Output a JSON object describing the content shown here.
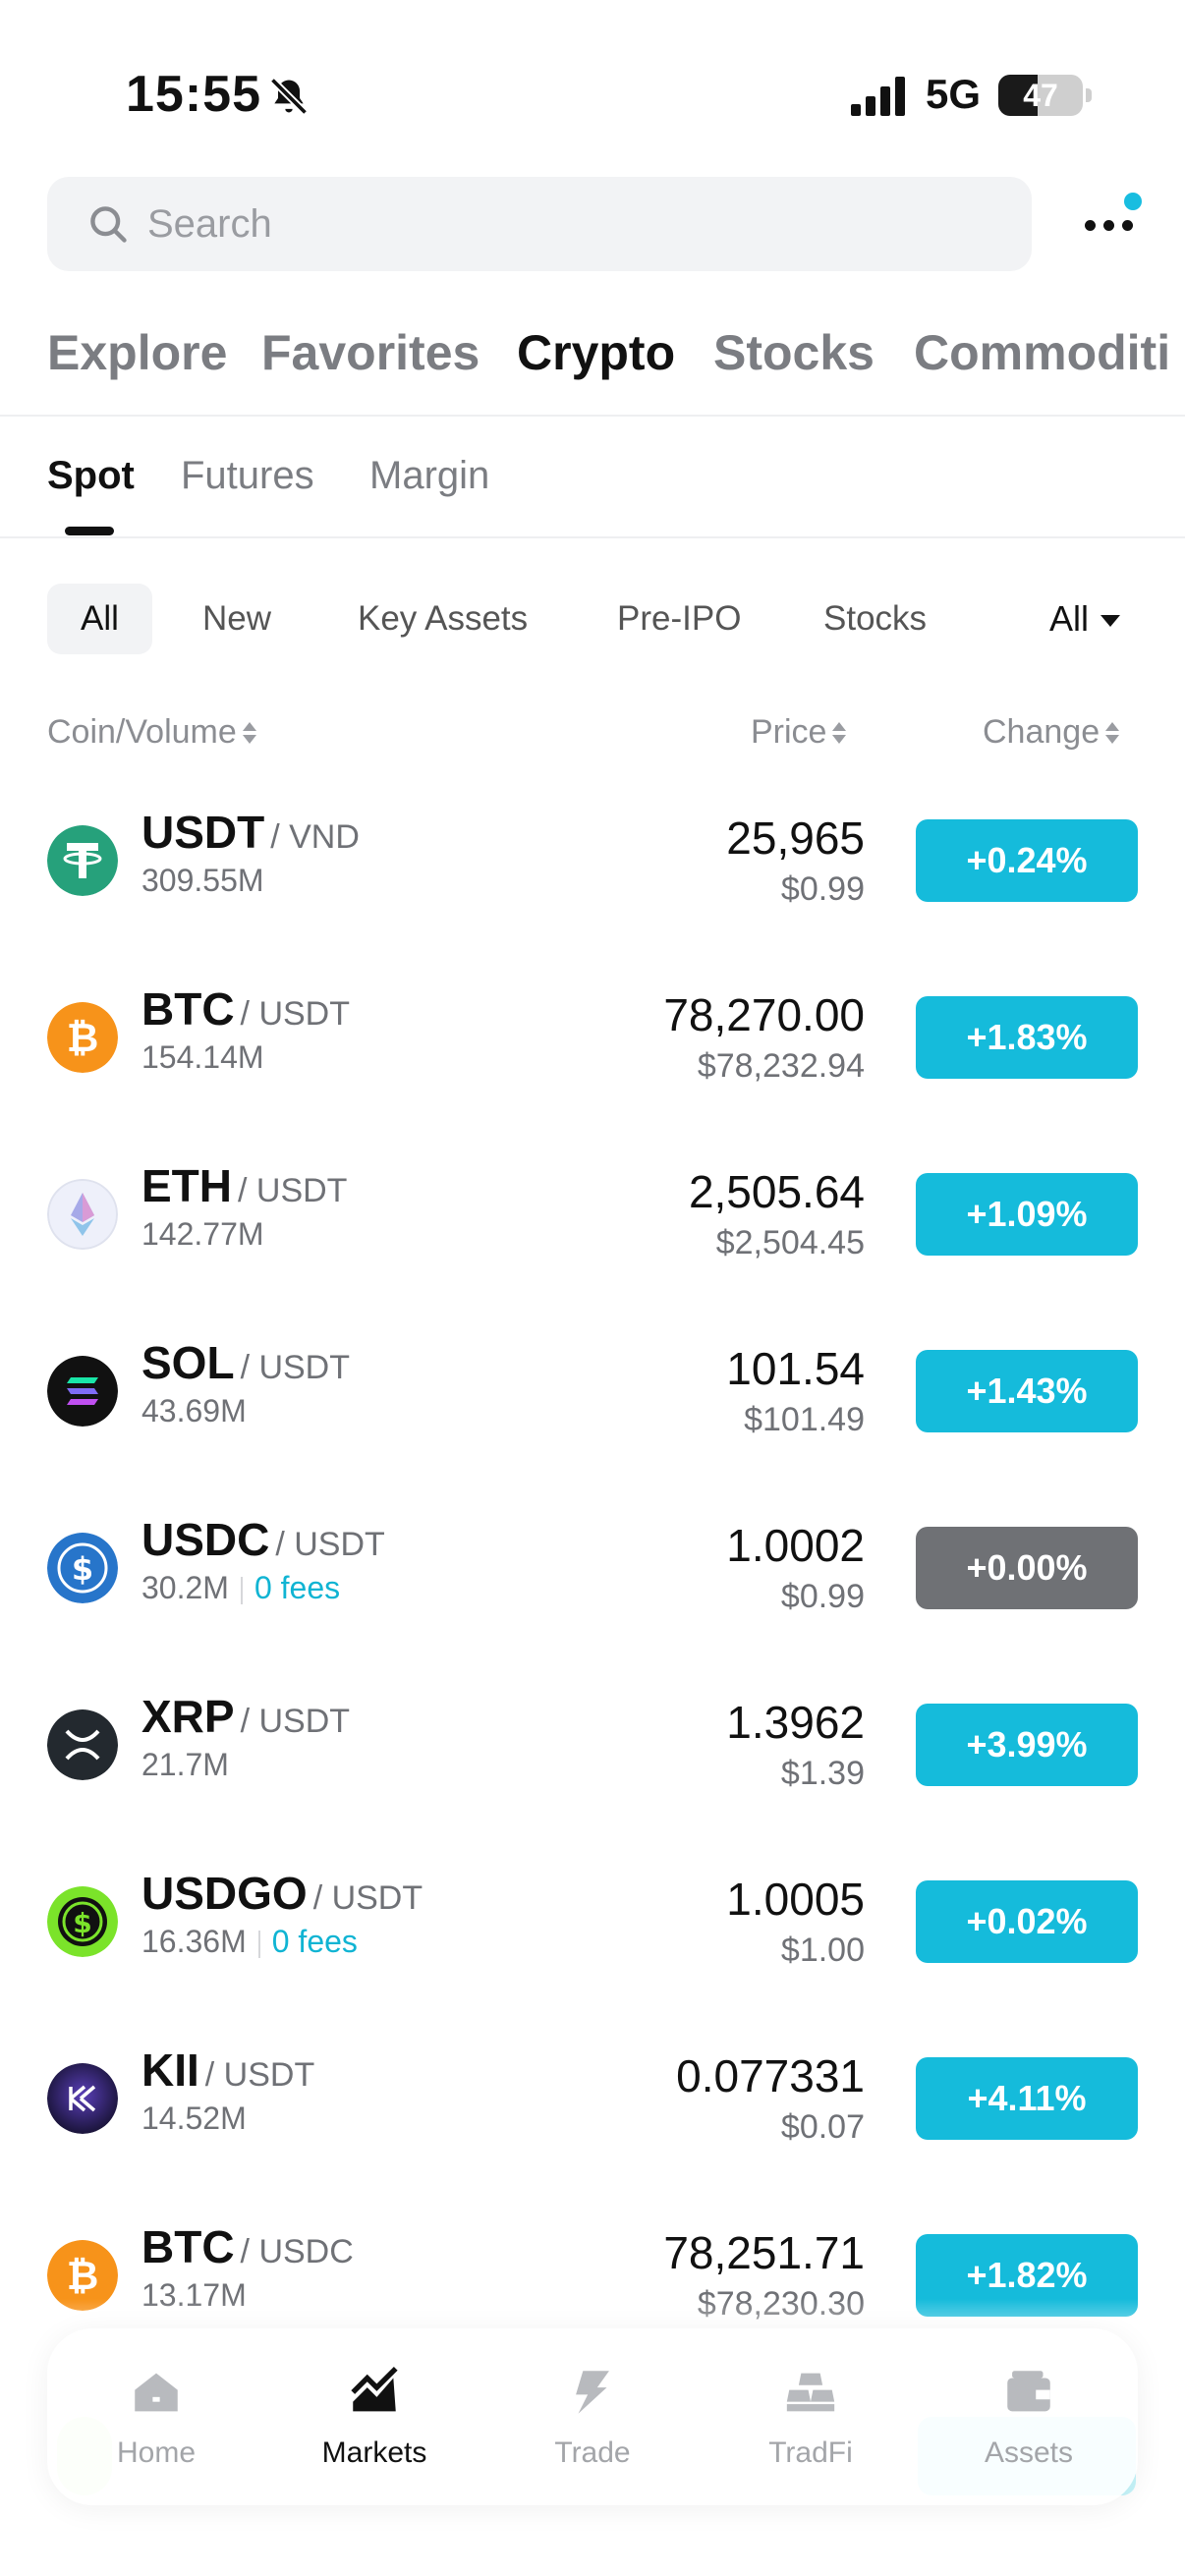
{
  "status_bar": {
    "time": "15:55",
    "network": "5G",
    "battery": "47",
    "battery_fraction": 0.47
  },
  "search": {
    "placeholder": "Search"
  },
  "main_tabs": [
    {
      "label": "Explore"
    },
    {
      "label": "Favorites"
    },
    {
      "label": "Crypto",
      "active": true
    },
    {
      "label": "Stocks"
    },
    {
      "label": "Commoditi"
    }
  ],
  "sub_tabs": [
    {
      "label": "Spot",
      "active": true
    },
    {
      "label": "Futures"
    },
    {
      "label": "Margin"
    }
  ],
  "filters": {
    "chips": [
      "All",
      "New",
      "Key Assets",
      "Pre-IPO",
      "Stocks"
    ],
    "dropdown": "All"
  },
  "table_header": {
    "coin": "Coin/Volume",
    "price": "Price",
    "change": "Change"
  },
  "rows": [
    {
      "base": "USDT",
      "quote": "/ VND",
      "volume": "309.55M",
      "fees": "",
      "price": "25,965",
      "usd": "$0.99",
      "change": "+0.24%",
      "icon": "tether-icon"
    },
    {
      "base": "BTC",
      "quote": "/ USDT",
      "volume": "154.14M",
      "fees": "",
      "price": "78,270.00",
      "usd": "$78,232.94",
      "change": "+1.83%",
      "icon": "bitcoin-icon"
    },
    {
      "base": "ETH",
      "quote": "/ USDT",
      "volume": "142.77M",
      "fees": "",
      "price": "2,505.64",
      "usd": "$2,504.45",
      "change": "+1.09%",
      "icon": "ethereum-icon"
    },
    {
      "base": "SOL",
      "quote": "/ USDT",
      "volume": "43.69M",
      "fees": "",
      "price": "101.54",
      "usd": "$101.49",
      "change": "+1.43%",
      "icon": "solana-icon"
    },
    {
      "base": "USDC",
      "quote": "/ USDT",
      "volume": "30.2M",
      "fees": "0 fees",
      "price": "1.0002",
      "usd": "$0.99",
      "change": "+0.00%",
      "icon": "usdc-icon"
    },
    {
      "base": "XRP",
      "quote": "/ USDT",
      "volume": "21.7M",
      "fees": "",
      "price": "1.3962",
      "usd": "$1.39",
      "change": "+3.99%",
      "icon": "xrp-icon"
    },
    {
      "base": "USDGO",
      "quote": "/ USDT",
      "volume": "16.36M",
      "fees": "0 fees",
      "price": "1.0005",
      "usd": "$1.00",
      "change": "+0.02%",
      "icon": "usdgo-icon"
    },
    {
      "base": "KII",
      "quote": "/ USDT",
      "volume": "14.52M",
      "fees": "",
      "price": "0.077331",
      "usd": "$0.07",
      "change": "+4.11%",
      "icon": "kii-icon"
    },
    {
      "base": "BTC",
      "quote": "/ USDC",
      "volume": "13.17M",
      "fees": "",
      "price": "78,251.71",
      "usd": "$78,230.30",
      "change": "+1.82%",
      "icon": "bitcoin-icon"
    }
  ],
  "bottom_nav": [
    {
      "label": "Home",
      "icon": "home-icon"
    },
    {
      "label": "Markets",
      "icon": "markets-chart-icon",
      "active": true
    },
    {
      "label": "Trade",
      "icon": "trade-arrows-icon"
    },
    {
      "label": "TradFi",
      "icon": "gold-bars-icon"
    },
    {
      "label": "Assets",
      "icon": "wallet-icon"
    }
  ],
  "colors": {
    "accent": "#15bbdb",
    "flat": "#6f7175",
    "fees": "#10b4d3",
    "text_primary": "#111111",
    "text_secondary": "#6f7176"
  }
}
